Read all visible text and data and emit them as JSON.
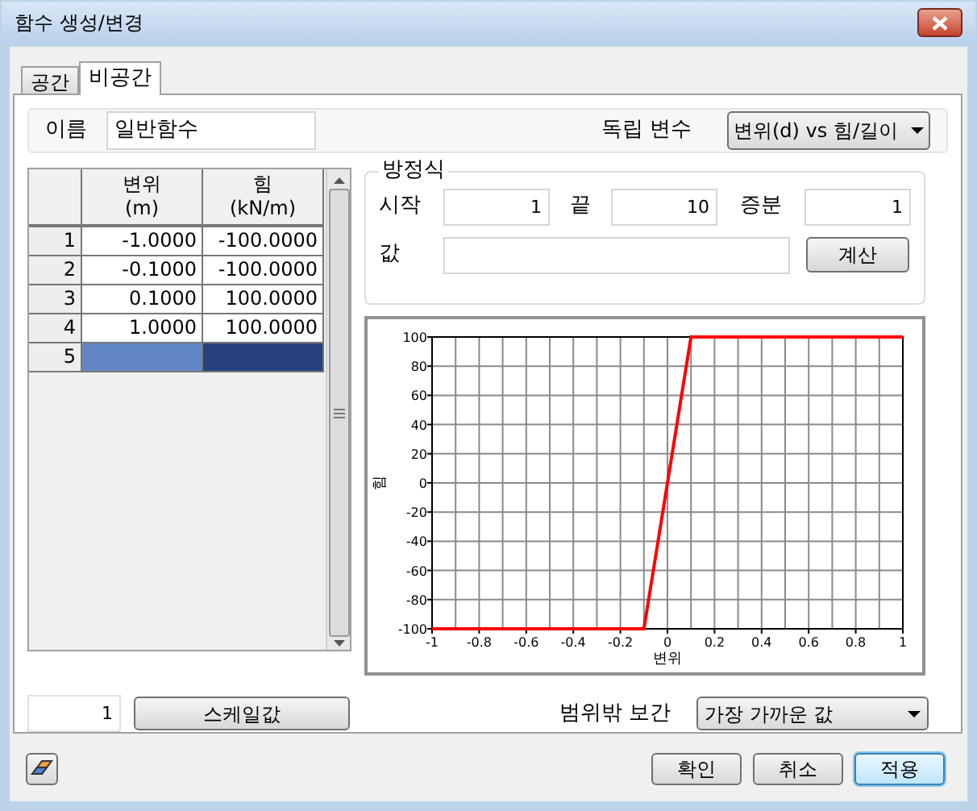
{
  "window": {
    "title": "함수 생성/변경"
  },
  "tabs": [
    {
      "label": "공간",
      "selected": false
    },
    {
      "label": "비공간",
      "selected": true
    }
  ],
  "name_field": {
    "label": "이름",
    "value": "일반함수"
  },
  "independent_variable": {
    "label": "독립 변수",
    "value": "변위(d) vs 힘/길이"
  },
  "table": {
    "columns": [
      {
        "title": "변위",
        "unit": "(m)"
      },
      {
        "title": "힘",
        "unit": "(kN/m)"
      }
    ],
    "rows": [
      {
        "row_header": "1",
        "cells": [
          "-1.0000",
          "-100.0000"
        ],
        "selected": false
      },
      {
        "row_header": "2",
        "cells": [
          "-0.1000",
          "-100.0000"
        ],
        "selected": false
      },
      {
        "row_header": "3",
        "cells": [
          "0.1000",
          "100.0000"
        ],
        "selected": false
      },
      {
        "row_header": "4",
        "cells": [
          "1.0000",
          "100.0000"
        ],
        "selected": false
      },
      {
        "row_header": "5",
        "cells": [
          "",
          ""
        ],
        "selected": true
      }
    ]
  },
  "equation": {
    "title": "방정식",
    "start_label": "시작",
    "start_value": "1",
    "end_label": "끝",
    "end_value": "10",
    "step_label": "증분",
    "step_value": "1",
    "value_label": "값",
    "compute_button": "계산"
  },
  "chart": {
    "chart_data": {
      "type": "line",
      "xlabel": "변위",
      "ylabel": "힘",
      "x": [
        -1,
        -0.1,
        0.1,
        1
      ],
      "series": [
        {
          "color": "#ff0000",
          "values": [
            -100,
            -100,
            100,
            100
          ]
        }
      ],
      "grid": true,
      "xlim": [
        -1,
        1
      ],
      "ylim": [
        -100,
        100
      ],
      "xticks": [
        -1,
        -0.8,
        -0.6,
        -0.4,
        -0.2,
        0,
        0.2,
        0.4,
        0.6,
        0.8,
        1
      ],
      "yticks": [
        -100,
        -80,
        -60,
        -40,
        -20,
        0,
        20,
        40,
        60,
        80,
        100
      ]
    }
  },
  "scale": {
    "value": "1",
    "button": "스케일값"
  },
  "extrapolation": {
    "label": "범위밖 보간",
    "value": "가장 가까운 값"
  },
  "buttons": [
    {
      "label": "확인",
      "default": false
    },
    {
      "label": "취소",
      "default": false
    },
    {
      "label": "적용",
      "default": true
    }
  ]
}
